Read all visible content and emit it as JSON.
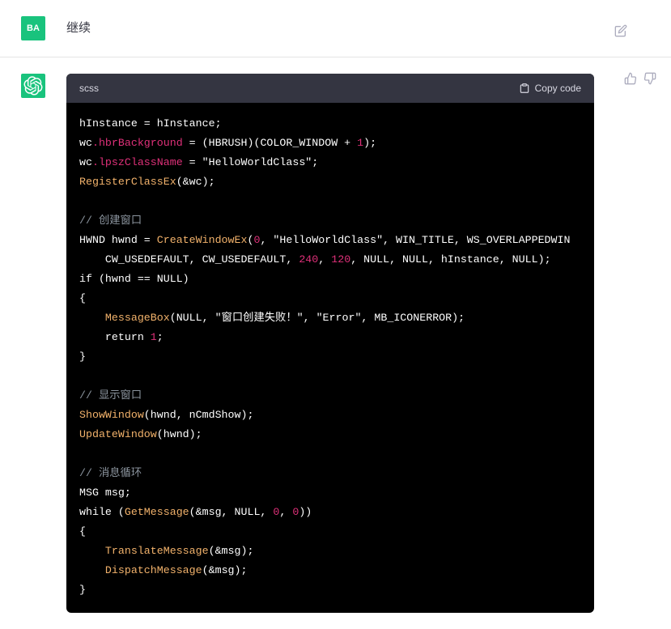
{
  "user": {
    "avatar_text": "BA",
    "message": "继续"
  },
  "assistant": {
    "code_lang": "scss",
    "copy_label": "Copy code"
  },
  "code": {
    "l1a": "hInstance = hInstance;",
    "l2a": "wc",
    "l2b": ".hbrBackground",
    "l2c": " = (HBRUSH)(COLOR_WINDOW + ",
    "l2d": "1",
    "l2e": ");",
    "l3a": "wc",
    "l3b": ".lpszClassName",
    "l3c": " = \"HelloWorldClass\";",
    "l4a": "RegisterClassEx",
    "l4b": "(&wc);",
    "c1": "// 创建窗口",
    "l5a": "HWND hwnd = ",
    "l5b": "CreateWindowEx",
    "l5c": "(",
    "l5d": "0",
    "l5e": ", \"HelloWorldClass\", WIN_TITLE, WS_OVERLAPPEDWIN",
    "l6a": "    CW_USEDEFAULT, CW_USEDEFAULT, ",
    "l6b": "240",
    "l6c": ", ",
    "l6d": "120",
    "l6e": ", NULL, NULL, hInstance, NULL);",
    "l7": "if (hwnd == NULL)",
    "l8": "{",
    "l9a": "    ",
    "l9b": "MessageBox",
    "l9c": "(NULL, \"窗口创建失败！\", \"Error\", MB_ICONERROR);",
    "l10a": "    return ",
    "l10b": "1",
    "l10c": ";",
    "l11": "}",
    "c2": "// 显示窗口",
    "l12a": "ShowWindow",
    "l12b": "(hwnd, nCmdShow);",
    "l13a": "UpdateWindow",
    "l13b": "(hwnd);",
    "c3": "// 消息循环",
    "l14": "MSG msg;",
    "l15a": "while (",
    "l15b": "GetMessage",
    "l15c": "(&msg, NULL, ",
    "l15d": "0",
    "l15e": ", ",
    "l15f": "0",
    "l15g": "))",
    "l16": "{",
    "l17a": "    ",
    "l17b": "TranslateMessage",
    "l17c": "(&msg);",
    "l18a": "    ",
    "l18b": "DispatchMessage",
    "l18c": "(&msg);",
    "l19": "}"
  }
}
